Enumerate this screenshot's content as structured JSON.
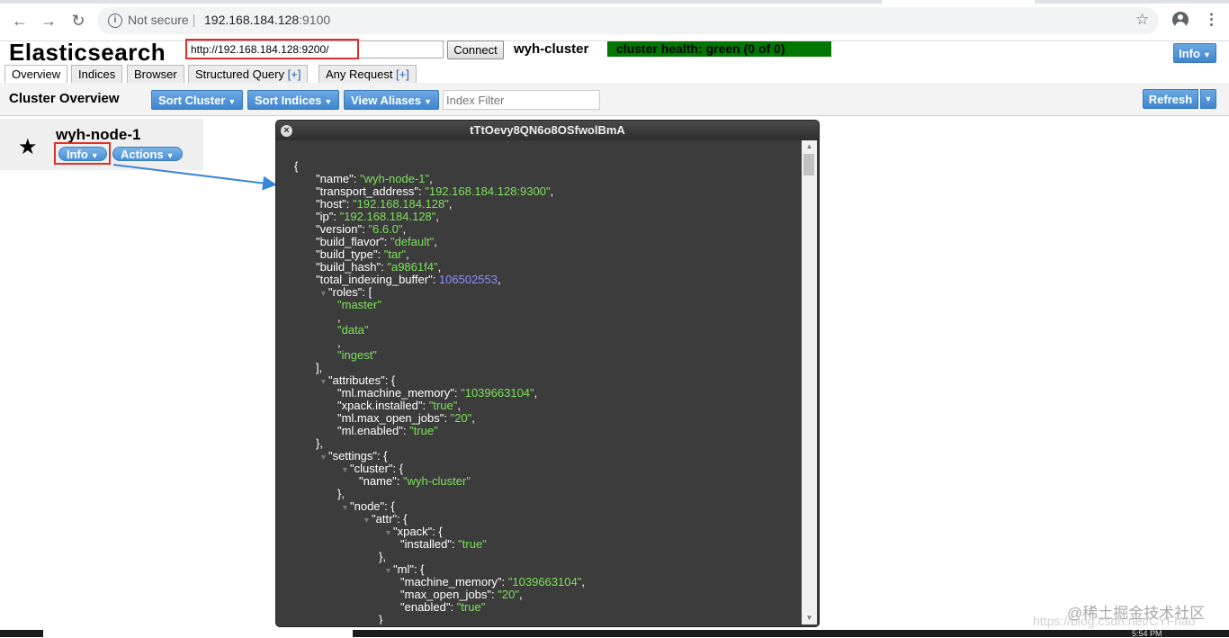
{
  "browser": {
    "security_label": "Not secure",
    "url_host": "192.168.184.128",
    "url_port": ":9100"
  },
  "header": {
    "app_title": "Elasticsearch",
    "connect_url": "http://192.168.184.128:9200/",
    "connect_label": "Connect",
    "cluster_name": "wyh-cluster",
    "cluster_health": "cluster health: green (0 of 0)",
    "info_label": "Info"
  },
  "tabs": [
    {
      "label": "Overview",
      "plus": ""
    },
    {
      "label": "Indices",
      "plus": ""
    },
    {
      "label": "Browser",
      "plus": ""
    },
    {
      "label": "Structured Query ",
      "plus": "[+]"
    },
    {
      "label": "Any Request ",
      "plus": "[+]"
    }
  ],
  "toolbar": {
    "title": "Cluster Overview",
    "sort_cluster": "Sort Cluster",
    "sort_indices": "Sort Indices",
    "view_aliases": "View Aliases",
    "index_filter_placeholder": "Index Filter",
    "refresh": "Refresh"
  },
  "node": {
    "name": "wyh-node-1",
    "info_label": "Info",
    "actions_label": "Actions"
  },
  "modal": {
    "title": "tTtOevy8QN6o8OSfwolBmA",
    "json_lines": [
      [
        {
          "t": "{",
          "c": "k"
        }
      ],
      [
        {
          "t": "\"name\": ",
          "c": "k"
        },
        {
          "t": "\"wyh-node-1\"",
          "c": "s"
        },
        {
          "t": ",",
          "c": "k"
        }
      ],
      [
        {
          "t": "\"transport_address\": ",
          "c": "k"
        },
        {
          "t": "\"192.168.184.128:9300\"",
          "c": "s"
        },
        {
          "t": ",",
          "c": "k"
        }
      ],
      [
        {
          "t": "\"host\": ",
          "c": "k"
        },
        {
          "t": "\"192.168.184.128\"",
          "c": "s"
        },
        {
          "t": ",",
          "c": "k"
        }
      ],
      [
        {
          "t": "\"ip\": ",
          "c": "k"
        },
        {
          "t": "\"192.168.184.128\"",
          "c": "s"
        },
        {
          "t": ",",
          "c": "k"
        }
      ],
      [
        {
          "t": "\"version\": ",
          "c": "k"
        },
        {
          "t": "\"6.6.0\"",
          "c": "s"
        },
        {
          "t": ",",
          "c": "k"
        }
      ],
      [
        {
          "t": "\"build_flavor\": ",
          "c": "k"
        },
        {
          "t": "\"default\"",
          "c": "s"
        },
        {
          "t": ",",
          "c": "k"
        }
      ],
      [
        {
          "t": "\"build_type\": ",
          "c": "k"
        },
        {
          "t": "\"tar\"",
          "c": "s"
        },
        {
          "t": ",",
          "c": "k"
        }
      ],
      [
        {
          "t": "\"build_hash\": ",
          "c": "k"
        },
        {
          "t": "\"a9861f4\"",
          "c": "s"
        },
        {
          "t": ",",
          "c": "k"
        }
      ],
      [
        {
          "t": "\"total_indexing_buffer\": ",
          "c": "k"
        },
        {
          "t": "106502553",
          "c": "n"
        },
        {
          "t": ",",
          "c": "k"
        }
      ],
      [
        {
          "t": "\"roles\": [",
          "c": "k"
        }
      ],
      [
        {
          "t": "\"master\"",
          "c": "s"
        }
      ],
      [
        {
          "t": ",",
          "c": "k"
        }
      ],
      [
        {
          "t": "\"data\"",
          "c": "s"
        }
      ],
      [
        {
          "t": ",",
          "c": "k"
        }
      ],
      [
        {
          "t": "\"ingest\"",
          "c": "s"
        }
      ],
      [
        {
          "t": "],",
          "c": "k"
        }
      ],
      [
        {
          "t": "\"attributes\": {",
          "c": "k"
        }
      ],
      [
        {
          "t": "\"ml.machine_memory\": ",
          "c": "k"
        },
        {
          "t": "\"1039663104\"",
          "c": "s"
        },
        {
          "t": ",",
          "c": "k"
        }
      ],
      [
        {
          "t": "\"xpack.installed\": ",
          "c": "k"
        },
        {
          "t": "\"true\"",
          "c": "s"
        },
        {
          "t": ",",
          "c": "k"
        }
      ],
      [
        {
          "t": "\"ml.max_open_jobs\": ",
          "c": "k"
        },
        {
          "t": "\"20\"",
          "c": "s"
        },
        {
          "t": ",",
          "c": "k"
        }
      ],
      [
        {
          "t": "\"ml.enabled\": ",
          "c": "k"
        },
        {
          "t": "\"true\"",
          "c": "s"
        }
      ],
      [
        {
          "t": "},",
          "c": "k"
        }
      ],
      [
        {
          "t": "\"settings\": {",
          "c": "k"
        }
      ],
      [
        {
          "t": "\"cluster\": {",
          "c": "k"
        }
      ],
      [
        {
          "t": "\"name\": ",
          "c": "k"
        },
        {
          "t": "\"wyh-cluster\"",
          "c": "s"
        }
      ],
      [
        {
          "t": "},",
          "c": "k"
        }
      ],
      [
        {
          "t": "\"node\": {",
          "c": "k"
        }
      ],
      [
        {
          "t": "\"attr\": {",
          "c": "k"
        }
      ],
      [
        {
          "t": "\"xpack\": {",
          "c": "k"
        }
      ],
      [
        {
          "t": "\"installed\": ",
          "c": "k"
        },
        {
          "t": "\"true\"",
          "c": "s"
        }
      ],
      [
        {
          "t": "},",
          "c": "k"
        }
      ],
      [
        {
          "t": "\"ml\": {",
          "c": "k"
        }
      ],
      [
        {
          "t": "\"machine_memory\": ",
          "c": "k"
        },
        {
          "t": "\"1039663104\"",
          "c": "s"
        },
        {
          "t": ",",
          "c": "k"
        }
      ],
      [
        {
          "t": "\"max_open_jobs\": ",
          "c": "k"
        },
        {
          "t": "\"20\"",
          "c": "s"
        },
        {
          "t": ",",
          "c": "k"
        }
      ],
      [
        {
          "t": "\"enabled\": ",
          "c": "k"
        },
        {
          "t": "\"true\"",
          "c": "s"
        }
      ],
      [
        {
          "t": "}",
          "c": "k"
        }
      ]
    ]
  },
  "watermark": {
    "brand": "@稀土掘金技术社区",
    "source": "https://blog.csdn.net/CYFhao"
  },
  "taskbar": {
    "time": "5:54 PM"
  },
  "colors": {
    "accent_blue": "#3f86cf",
    "health_green": "#007700",
    "highlight_red": "#e0302a",
    "json_string": "#7ee05b",
    "json_number": "#8d8dff"
  }
}
